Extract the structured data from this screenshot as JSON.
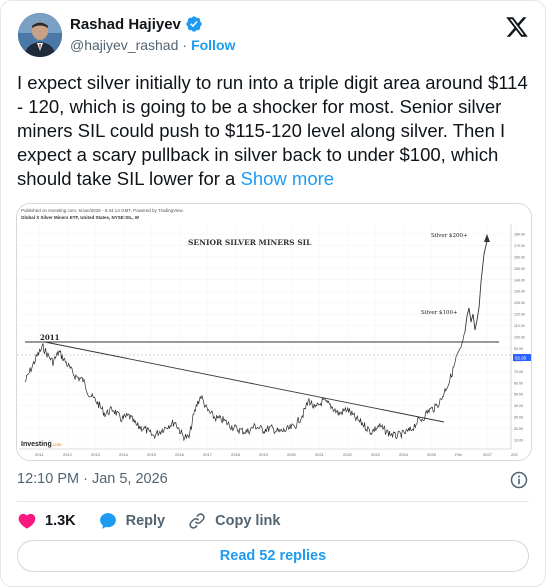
{
  "author": {
    "name": "Rashad Hajiyev",
    "handle": "@hajiyev_rashad",
    "separator": "·",
    "follow_label": "Follow"
  },
  "tweet": {
    "text": "I expect silver initially to run into a triple digit area around $114 - 120, which is going to be a shocker for most. Senior silver miners SIL could push to $115-120 level along silver. Then I expect a scary pullback in silver back to under $100, which should take SIL lower for a ",
    "show_more": "Show more",
    "timestamp": "12:10 PM · Jan 5, 2026"
  },
  "chart": {
    "published": "Published on Investing.com, 5/Jan/2026 - 8:34:14 GMT, Powered by TradingView.",
    "instrument": "Global X Silver Miners ETF, United States, NYSE:SIL, W",
    "title": "SENIOR SILVER MINERS SIL",
    "label_2011": "2011",
    "label_silver_100": "Silver $100+",
    "label_silver_200": "Silver $200+",
    "watermark": "Investing",
    "watermark_suffix": ".com",
    "x_ticks": [
      "2011",
      "2012",
      "2013",
      "2014",
      "2015",
      "2016",
      "2017",
      "2018",
      "2019",
      "2020",
      "2021",
      "2022",
      "2023",
      "2024",
      "2025",
      "Feb",
      "2027",
      "202"
    ],
    "y_ticks": [
      "180.00",
      "170.00",
      "160.00",
      "150.00",
      "140.00",
      "130.00",
      "125.00",
      "120.00",
      "110.00",
      "100.00",
      "90.00",
      "80.00",
      "70.00",
      "60.00",
      "50.00",
      "40.00",
      "30.00",
      "20.00",
      "10.00"
    ],
    "price_badge": "92.95"
  },
  "actions": {
    "like_count": "1.3K",
    "reply_label": "Reply",
    "copy_label": "Copy link"
  },
  "replies_button": "Read 52 replies",
  "colors": {
    "accent": "#1d9bf0",
    "like": "#f91880",
    "secondary_text": "#536471"
  }
}
